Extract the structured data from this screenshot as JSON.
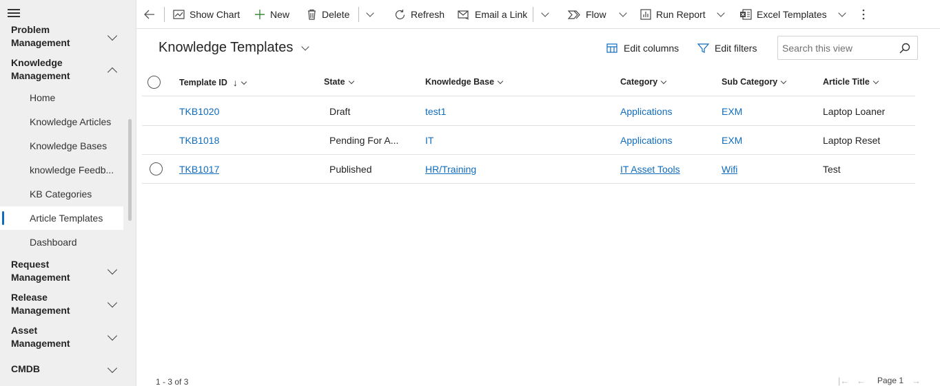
{
  "sidebar": {
    "groups": [
      {
        "label_line1": "Problem",
        "label_line2": "Management",
        "expanded": false
      },
      {
        "label_line1": "Knowledge",
        "label_line2": "Management",
        "expanded": true
      },
      {
        "label_line1": "Request",
        "label_line2": "Management",
        "expanded": false
      },
      {
        "label_line1": "Release",
        "label_line2": "Management",
        "expanded": false
      },
      {
        "label_line1": "Asset",
        "label_line2": "Management",
        "expanded": false
      },
      {
        "label_line1": "CMDB",
        "label_line2": "",
        "expanded": false
      }
    ],
    "items": [
      {
        "label": "Home"
      },
      {
        "label": "Knowledge Articles"
      },
      {
        "label": "Knowledge Bases"
      },
      {
        "label": "knowledge Feedb..."
      },
      {
        "label": "KB Categories"
      },
      {
        "label": "Article Templates",
        "active": true
      },
      {
        "label": "Dashboard"
      }
    ]
  },
  "toolbar": {
    "show_chart": "Show Chart",
    "new": "New",
    "delete": "Delete",
    "refresh": "Refresh",
    "email_link": "Email a Link",
    "flow": "Flow",
    "run_report": "Run Report",
    "excel_templates": "Excel Templates"
  },
  "view": {
    "title": "Knowledge Templates",
    "edit_columns": "Edit columns",
    "edit_filters": "Edit filters",
    "search_placeholder": "Search this view"
  },
  "grid": {
    "columns": [
      "Template ID",
      "State",
      "Knowledge Base",
      "Category",
      "Sub Category",
      "Article Title"
    ],
    "sort_indicator": "↓",
    "rows": [
      {
        "template_id": "TKB1020",
        "state": "Draft",
        "knowledge_base": "test1",
        "category": "Applications",
        "sub_category": "EXM",
        "article_title": "Laptop Loaner"
      },
      {
        "template_id": "TKB1018",
        "state": "Pending For A...",
        "knowledge_base": "IT",
        "category": "Applications",
        "sub_category": "EXM",
        "article_title": "Laptop Reset"
      },
      {
        "template_id": "TKB1017",
        "state": "Published",
        "knowledge_base": "HR/Training",
        "category": "IT Asset Tools",
        "sub_category": "Wifi",
        "article_title": "Test"
      }
    ]
  },
  "footer": {
    "count": "1 - 3 of 3",
    "page": "Page 1"
  },
  "colors": {
    "link": "#0f6cbd",
    "accent": "#0f6cbd",
    "sidebar_bg": "#efefef"
  }
}
